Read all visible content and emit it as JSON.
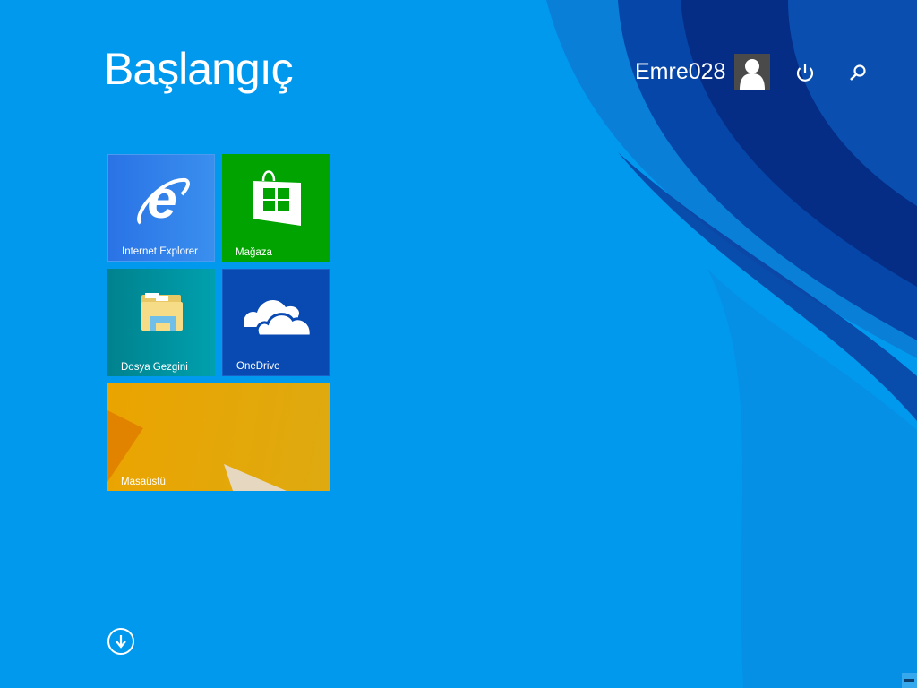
{
  "header": {
    "title": "Başlangıç",
    "user_name": "Emre028"
  },
  "tiles": [
    {
      "label": "Internet Explorer",
      "color": "#2f7ee9",
      "icon": "internet-explorer-icon"
    },
    {
      "label": "Mağaza",
      "color": "#00a300",
      "icon": "store-bag-icon"
    },
    {
      "label": "Dosya Gezgini",
      "color": "#008f9c",
      "icon": "file-explorer-folder-icon"
    },
    {
      "label": "OneDrive",
      "color": "#094ab2",
      "icon": "cloud-icon"
    },
    {
      "label": "Masaüstü",
      "color": "#e8a900",
      "icon": "desktop-wallpaper"
    }
  ],
  "colors": {
    "background": "#0199ee",
    "accent_dark": "#0a3a9a"
  }
}
